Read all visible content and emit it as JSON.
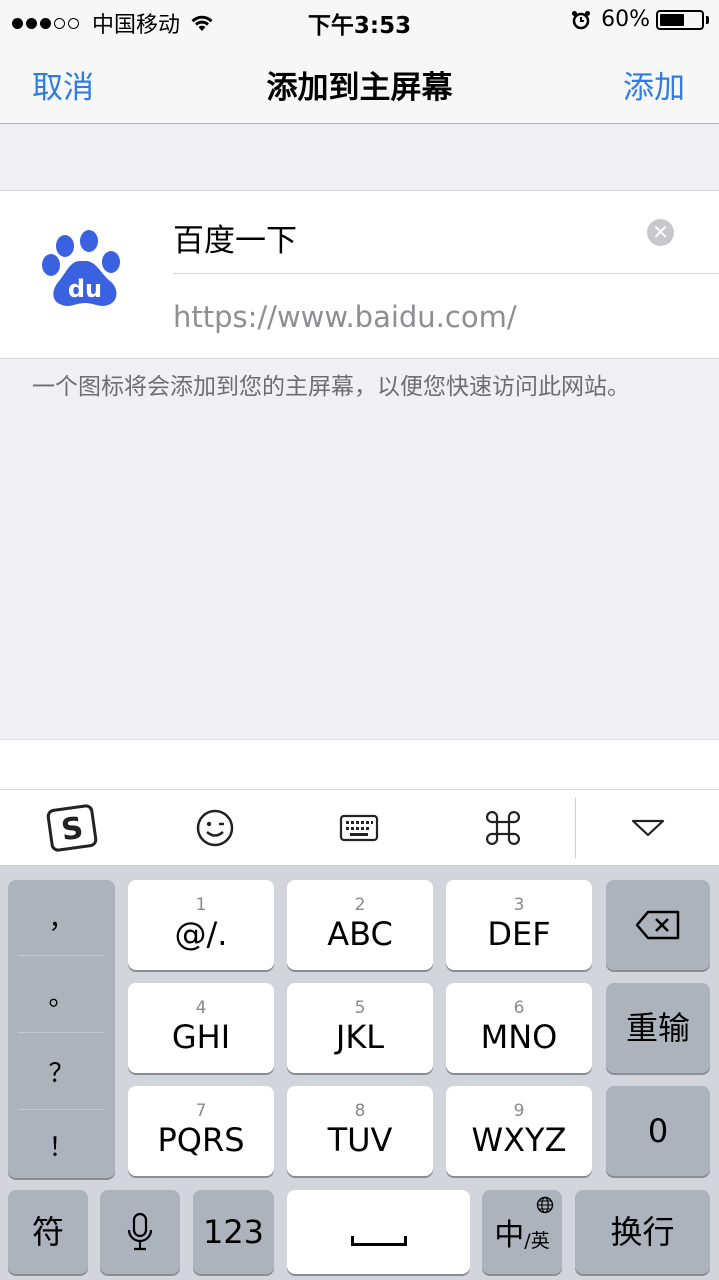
{
  "status_bar": {
    "carrier": "中国移动",
    "time": "下午3:53",
    "battery_percent": "60%",
    "battery_level": 0.6,
    "signal_bars_filled": 3,
    "signal_bars_total": 5
  },
  "nav": {
    "cancel_label": "取消",
    "title": "添加到主屏幕",
    "add_label": "添加"
  },
  "form": {
    "title_value": "百度一下",
    "url": "https://www.baidu.com/",
    "icon_text": "du"
  },
  "hint": "一个图标将会添加到您的主屏幕，以便您快速访问此网站。",
  "keyboard": {
    "toolbar_icons": [
      "sogou-logo-icon",
      "emoji-icon",
      "keyboard-icon",
      "command-icon",
      "collapse-triangle-icon"
    ],
    "punctuation": [
      "，",
      "。",
      "？",
      "！"
    ],
    "keys": [
      {
        "num": "1",
        "label": "@/."
      },
      {
        "num": "2",
        "label": "ABC"
      },
      {
        "num": "3",
        "label": "DEF"
      },
      {
        "num": "4",
        "label": "GHI"
      },
      {
        "num": "5",
        "label": "JKL"
      },
      {
        "num": "6",
        "label": "MNO"
      },
      {
        "num": "7",
        "label": "PQRS"
      },
      {
        "num": "8",
        "label": "TUV"
      },
      {
        "num": "9",
        "label": "WXYZ"
      }
    ],
    "retype_label": "重输",
    "zero_label": "0",
    "symbol_label": "符",
    "num_label": "123",
    "lang_main": "中",
    "lang_sub": "/英",
    "return_label": "换行"
  },
  "colors": {
    "accent": "#2f7ce6",
    "baidu_blue": "#3a61e0"
  }
}
